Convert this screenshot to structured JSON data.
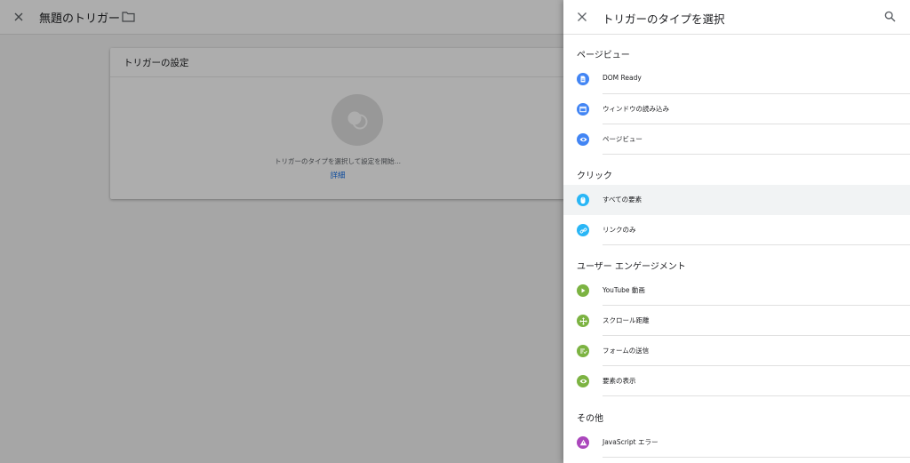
{
  "editor": {
    "title": "無題のトリガー",
    "card": {
      "title": "トリガーの設定",
      "hint": "トリガーのタイプを選択して設定を開始...",
      "link": "詳細"
    }
  },
  "panel": {
    "title": "トリガーのタイプを選択",
    "sections": {
      "pageview": {
        "heading": "ページビュー",
        "items": [
          {
            "label": "DOM Ready",
            "icon": "document-icon",
            "color": "#4285f4"
          },
          {
            "label": "ウィンドウの読み込み",
            "icon": "window-icon",
            "color": "#4285f4"
          },
          {
            "label": "ページビュー",
            "icon": "eye-icon",
            "color": "#4285f4"
          }
        ]
      },
      "click": {
        "heading": "クリック",
        "items": [
          {
            "label": "すべての要素",
            "icon": "mouse-icon",
            "color": "#29b6f6"
          },
          {
            "label": "リンクのみ",
            "icon": "link-icon",
            "color": "#29b6f6"
          }
        ]
      },
      "engagement": {
        "heading": "ユーザー エンゲージメント",
        "items": [
          {
            "label": "YouTube 動画",
            "icon": "play-icon",
            "color": "#7cb342"
          },
          {
            "label": "スクロール距離",
            "icon": "move-icon",
            "color": "#7cb342"
          },
          {
            "label": "フォームの送信",
            "icon": "form-submit-icon",
            "color": "#7cb342"
          },
          {
            "label": "要素の表示",
            "icon": "eye-icon",
            "color": "#7cb342"
          }
        ]
      },
      "other": {
        "heading": "その他",
        "items": [
          {
            "label": "JavaScript エラー",
            "icon": "warning-icon",
            "color": "#ab47bc"
          }
        ]
      }
    }
  }
}
